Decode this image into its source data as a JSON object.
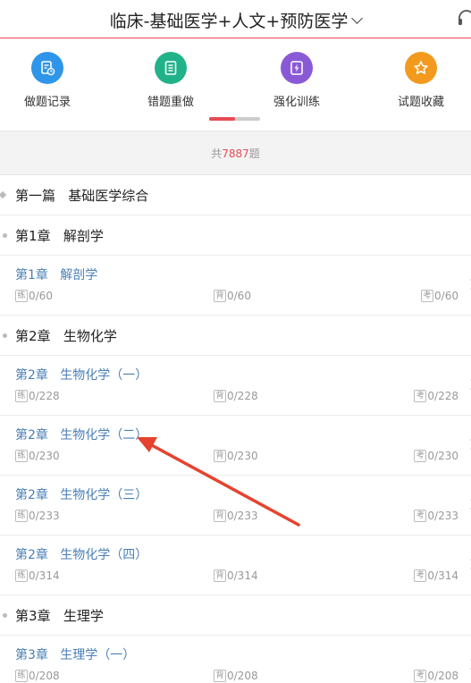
{
  "header": {
    "title": "临床-基础医学+人文+预防医学"
  },
  "quick_actions": [
    {
      "label": "做题记录",
      "color": "#2f95e8",
      "icon": "history-icon"
    },
    {
      "label": "错题重做",
      "color": "#21b28a",
      "icon": "notebook-icon"
    },
    {
      "label": "强化训练",
      "color": "#8a5ad6",
      "icon": "lightning-icon"
    },
    {
      "label": "试题收藏",
      "color": "#f39a1e",
      "icon": "star-icon"
    }
  ],
  "summary": {
    "prefix": "共",
    "total": "7887",
    "suffix": "题"
  },
  "tags": {
    "practice": "练",
    "memorize": "背",
    "exam": "考"
  },
  "sections": [
    {
      "kind": "part",
      "label": "第一篇   基础医学综合"
    },
    {
      "kind": "chapter",
      "label": "第1章   解剖学"
    },
    {
      "kind": "lesson",
      "title": "第1章   解剖学",
      "practice": "0/60",
      "memorize": "0/60",
      "exam": "0/60"
    },
    {
      "kind": "chapter",
      "label": "第2章   生物化学"
    },
    {
      "kind": "lesson",
      "title": "第2章   生物化学（一）",
      "practice": "0/228",
      "memorize": "0/228",
      "exam": "0/228"
    },
    {
      "kind": "lesson",
      "title": "第2章   生物化学（二）",
      "practice": "0/230",
      "memorize": "0/230",
      "exam": "0/230"
    },
    {
      "kind": "lesson",
      "title": "第2章   生物化学（三）",
      "practice": "0/233",
      "memorize": "0/233",
      "exam": "0/233"
    },
    {
      "kind": "lesson",
      "title": "第2章   生物化学（四）",
      "practice": "0/314",
      "memorize": "0/314",
      "exam": "0/314"
    },
    {
      "kind": "chapter",
      "label": "第3章   生理学"
    },
    {
      "kind": "lesson",
      "title": "第3章   生理学（一）",
      "practice": "0/208",
      "memorize": "0/208",
      "exam": "0/208"
    }
  ],
  "colors": {
    "accent": "#e84b56",
    "link": "#4a7fb5"
  }
}
